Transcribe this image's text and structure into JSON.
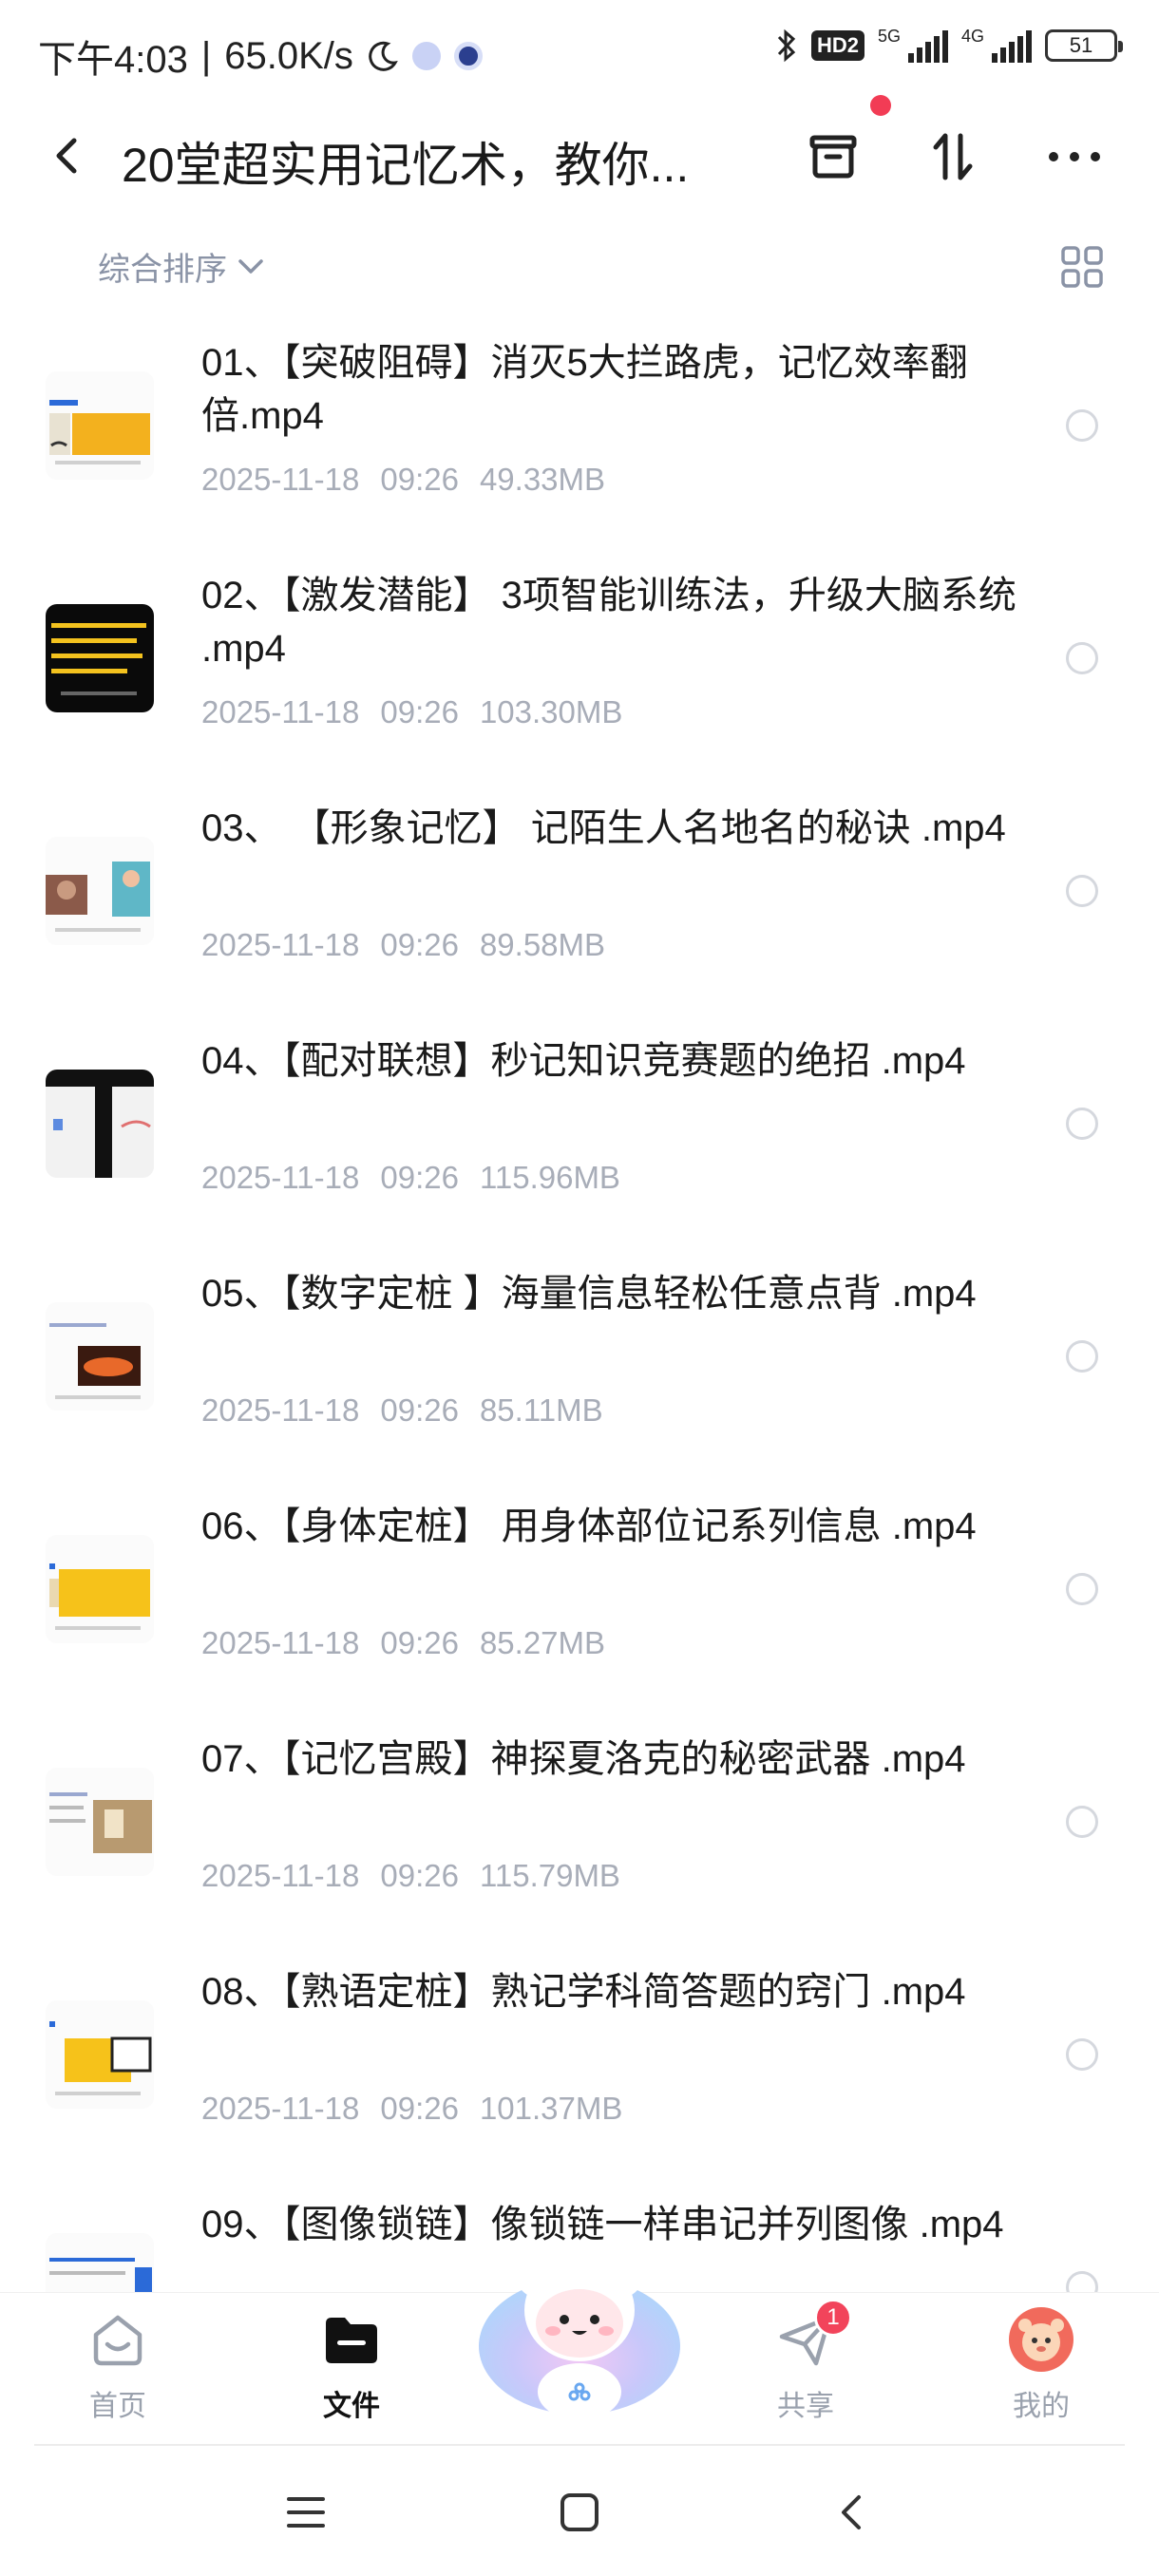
{
  "status_bar": {
    "time": "下午4:03",
    "speed": "65.0K/s",
    "hd_badge": "HD2",
    "net1": "5G",
    "net2": "4G",
    "battery": "51"
  },
  "header": {
    "title": "20堂超实用记忆术，教你..."
  },
  "sort": {
    "label": "综合排序"
  },
  "files": [
    {
      "name": "01、【突破阻碍】消灭5大拦路虎，记忆效率翻倍.mp4",
      "date": "2025-11-18",
      "time": "09:26",
      "size": "49.33MB"
    },
    {
      "name": "02、【激发潜能】 3项智能训练法，升级大脑系统 .mp4",
      "date": "2025-11-18",
      "time": "09:26",
      "size": "103.30MB"
    },
    {
      "name": "03、 【形象记忆】 记陌生人名地名的秘诀 .mp4",
      "date": "2025-11-18",
      "time": "09:26",
      "size": "89.58MB"
    },
    {
      "name": "04、【配对联想】秒记知识竞赛题的绝招 .mp4",
      "date": "2025-11-18",
      "time": "09:26",
      "size": "115.96MB"
    },
    {
      "name": "05、【数字定桩 】海量信息轻松任意点背 .mp4",
      "date": "2025-11-18",
      "time": "09:26",
      "size": "85.11MB"
    },
    {
      "name": "06、【身体定桩】 用身体部位记系列信息 .mp4",
      "date": "2025-11-18",
      "time": "09:26",
      "size": "85.27MB"
    },
    {
      "name": "07、【记忆宫殿】神探夏洛克的秘密武器 .mp4",
      "date": "2025-11-18",
      "time": "09:26",
      "size": "115.79MB"
    },
    {
      "name": "08、【熟语定桩】熟记学科简答题的窍门 .mp4",
      "date": "2025-11-18",
      "time": "09:26",
      "size": "101.37MB"
    },
    {
      "name": "09、【图像锁链】像锁链一样串记并列图像 .mp4",
      "date": "",
      "time": "",
      "size": ""
    }
  ],
  "bottom_nav": {
    "home": "首页",
    "files": "文件",
    "share": "共享",
    "share_badge": "1",
    "mine": "我的"
  },
  "colors": {
    "accent_red": "#f23c55",
    "meta_gray": "#a8adb8",
    "sort_gray": "#8a93a6"
  }
}
